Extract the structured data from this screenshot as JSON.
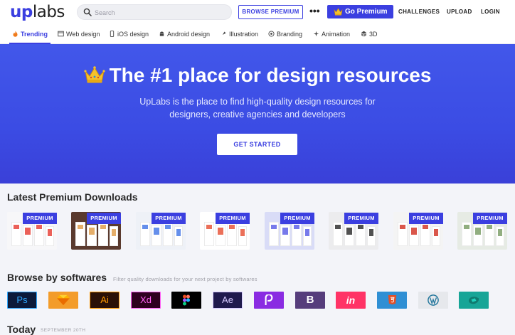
{
  "header": {
    "logo_up": "up",
    "logo_labs": "labs",
    "search_placeholder": "Search",
    "browse_premium": "BROWSE PREMIUM",
    "more": "•••",
    "go_premium": "Go Premium",
    "nav": [
      "CHALLENGES",
      "UPLOAD",
      "LOGIN"
    ]
  },
  "tabs": [
    {
      "label": "Trending",
      "icon": "fire-icon",
      "active": true
    },
    {
      "label": "Web design",
      "icon": "browser-icon"
    },
    {
      "label": "iOS design",
      "icon": "phone-icon"
    },
    {
      "label": "Android design",
      "icon": "android-icon"
    },
    {
      "label": "Illustration",
      "icon": "brush-icon"
    },
    {
      "label": "Branding",
      "icon": "target-icon"
    },
    {
      "label": "Animation",
      "icon": "animation-icon"
    },
    {
      "label": "3D",
      "icon": "cube-icon"
    }
  ],
  "hero": {
    "title": "The #1 place for design resources",
    "subtitle_line1": "UpLabs is the place to find high-quality design resources for",
    "subtitle_line2": "designers, creative agencies and developers",
    "cta": "GET STARTED"
  },
  "premium": {
    "title": "Latest Premium Downloads",
    "badge": "PREMIUM",
    "items": [
      {
        "bg": "#f7f7f9",
        "accent": "#e8453c"
      },
      {
        "bg": "#5a3a2e",
        "accent": "#e0a050"
      },
      {
        "bg": "#eef1f7",
        "accent": "#4a7be8"
      },
      {
        "bg": "#ffffff",
        "accent": "#e8573c"
      },
      {
        "bg": "#d9dcf7",
        "accent": "#5f63e8"
      },
      {
        "bg": "#ececee",
        "accent": "#333333"
      },
      {
        "bg": "#f4f4f4",
        "accent": "#d33a2c"
      },
      {
        "bg": "#e6ebe4",
        "accent": "#7ea06a"
      }
    ]
  },
  "softwares": {
    "title": "Browse by softwares",
    "subtitle": "Filter quality downloads for your next project by softwares",
    "items": [
      {
        "label": "Ps",
        "name": "photoshop-icon",
        "bg": "#0c1a3a",
        "fg": "#31a8ff"
      },
      {
        "label": "",
        "name": "sketch-icon",
        "bg": "#f39c2a",
        "fg": "#ffffff"
      },
      {
        "label": "Ai",
        "name": "illustrator-icon",
        "bg": "#2b1106",
        "fg": "#ff9a00"
      },
      {
        "label": "Xd",
        "name": "xd-icon",
        "bg": "#2e001f",
        "fg": "#ff61f6"
      },
      {
        "label": "",
        "name": "figma-icon",
        "bg": "#000000",
        "fg": "#ffffff"
      },
      {
        "label": "Ae",
        "name": "after-effects-icon",
        "bg": "#1f1a4d",
        "fg": "#d5c9ff"
      },
      {
        "label": "",
        "name": "principle-icon",
        "bg": "#8a2be2",
        "fg": "#ffffff"
      },
      {
        "label": "B",
        "name": "bootstrap-icon",
        "bg": "#563d7c",
        "fg": "#ffffff"
      },
      {
        "label": "in",
        "name": "invision-icon",
        "bg": "#ff3366",
        "fg": "#ffffff"
      },
      {
        "label": "",
        "name": "html5-icon",
        "bg": "#2f8fd4",
        "fg": "#ffffff"
      },
      {
        "label": "",
        "name": "wordpress-icon",
        "bg": "#e6e8ec",
        "fg": "#21759b"
      },
      {
        "label": "",
        "name": "zeplin-icon",
        "bg": "#17a597",
        "fg": "#ffffff"
      }
    ]
  },
  "today": {
    "title": "Today",
    "date": "SEPTEMBER 20TH"
  }
}
